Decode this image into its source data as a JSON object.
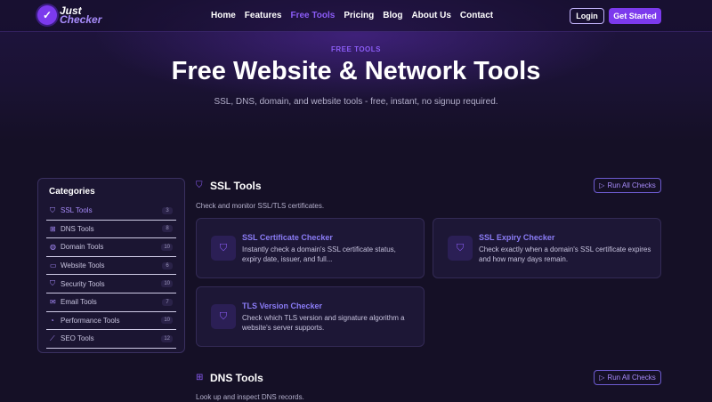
{
  "brand": {
    "line1": "Just",
    "line2": "Checker",
    "mark": "✓"
  },
  "nav": {
    "links": [
      {
        "label": "Home"
      },
      {
        "label": "Features"
      },
      {
        "label": "Free Tools"
      },
      {
        "label": "Pricing"
      },
      {
        "label": "Blog"
      },
      {
        "label": "About Us"
      },
      {
        "label": "Contact"
      }
    ],
    "active_index": 2,
    "login_label": "Login",
    "start_label": "Get Started"
  },
  "hero": {
    "eyebrow": "FREE TOOLS",
    "title": "Free Website & Network Tools",
    "subtitle": "SSL, DNS, domain, and website tools - free, instant, no signup required."
  },
  "sidebar": {
    "title": "Categories",
    "items": [
      {
        "label": "SSL Tools",
        "count": "3",
        "icon": "shield-icon"
      },
      {
        "label": "DNS Tools",
        "count": "8",
        "icon": "network-icon"
      },
      {
        "label": "Domain Tools",
        "count": "10",
        "icon": "globe-icon"
      },
      {
        "label": "Website Tools",
        "count": "6",
        "icon": "browser-icon"
      },
      {
        "label": "Security Tools",
        "count": "10",
        "icon": "shield-icon"
      },
      {
        "label": "Email Tools",
        "count": "7",
        "icon": "mail-icon"
      },
      {
        "label": "Performance Tools",
        "count": "10",
        "icon": "gauge-icon"
      },
      {
        "label": "SEO Tools",
        "count": "12",
        "icon": "chart-icon"
      }
    ]
  },
  "sections": {
    "ssl": {
      "title": "SSL Tools",
      "description": "Check and monitor SSL/TLS certificates.",
      "run_label": "Run All Checks",
      "cards": [
        {
          "title": "SSL Certificate Checker",
          "description": "Instantly check a domain's SSL certificate status, expiry date, issuer, and full..."
        },
        {
          "title": "SSL Expiry Checker",
          "description": "Check exactly when a domain's SSL certificate expires and how many days remain."
        },
        {
          "title": "TLS Version Checker",
          "description": "Check which TLS version and signature algorithm a website's server supports."
        }
      ]
    },
    "dns": {
      "title": "DNS Tools",
      "description": "Look up and inspect DNS records.",
      "run_label": "Run All Checks"
    }
  },
  "colors": {
    "accent": "#7c3aed",
    "background": "#151026",
    "card": "#1d1736"
  }
}
